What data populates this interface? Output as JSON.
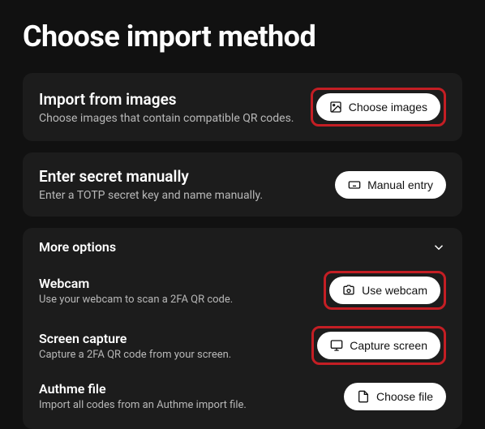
{
  "title": "Choose import method",
  "cards": {
    "images": {
      "title": "Import from images",
      "desc": "Choose images that contain compatible QR codes.",
      "button": "Choose images"
    },
    "manual": {
      "title": "Enter secret manually",
      "desc": "Enter a TOTP secret key and name manually.",
      "button": "Manual entry"
    }
  },
  "more": {
    "header": "More options",
    "webcam": {
      "title": "Webcam",
      "desc": "Use your webcam to scan a 2FA QR code.",
      "button": "Use webcam"
    },
    "screen": {
      "title": "Screen capture",
      "desc": "Capture a 2FA QR code from your screen.",
      "button": "Capture screen"
    },
    "authme": {
      "title": "Authme file",
      "desc": "Import all codes from an Authme import file.",
      "button": "Choose file"
    }
  }
}
